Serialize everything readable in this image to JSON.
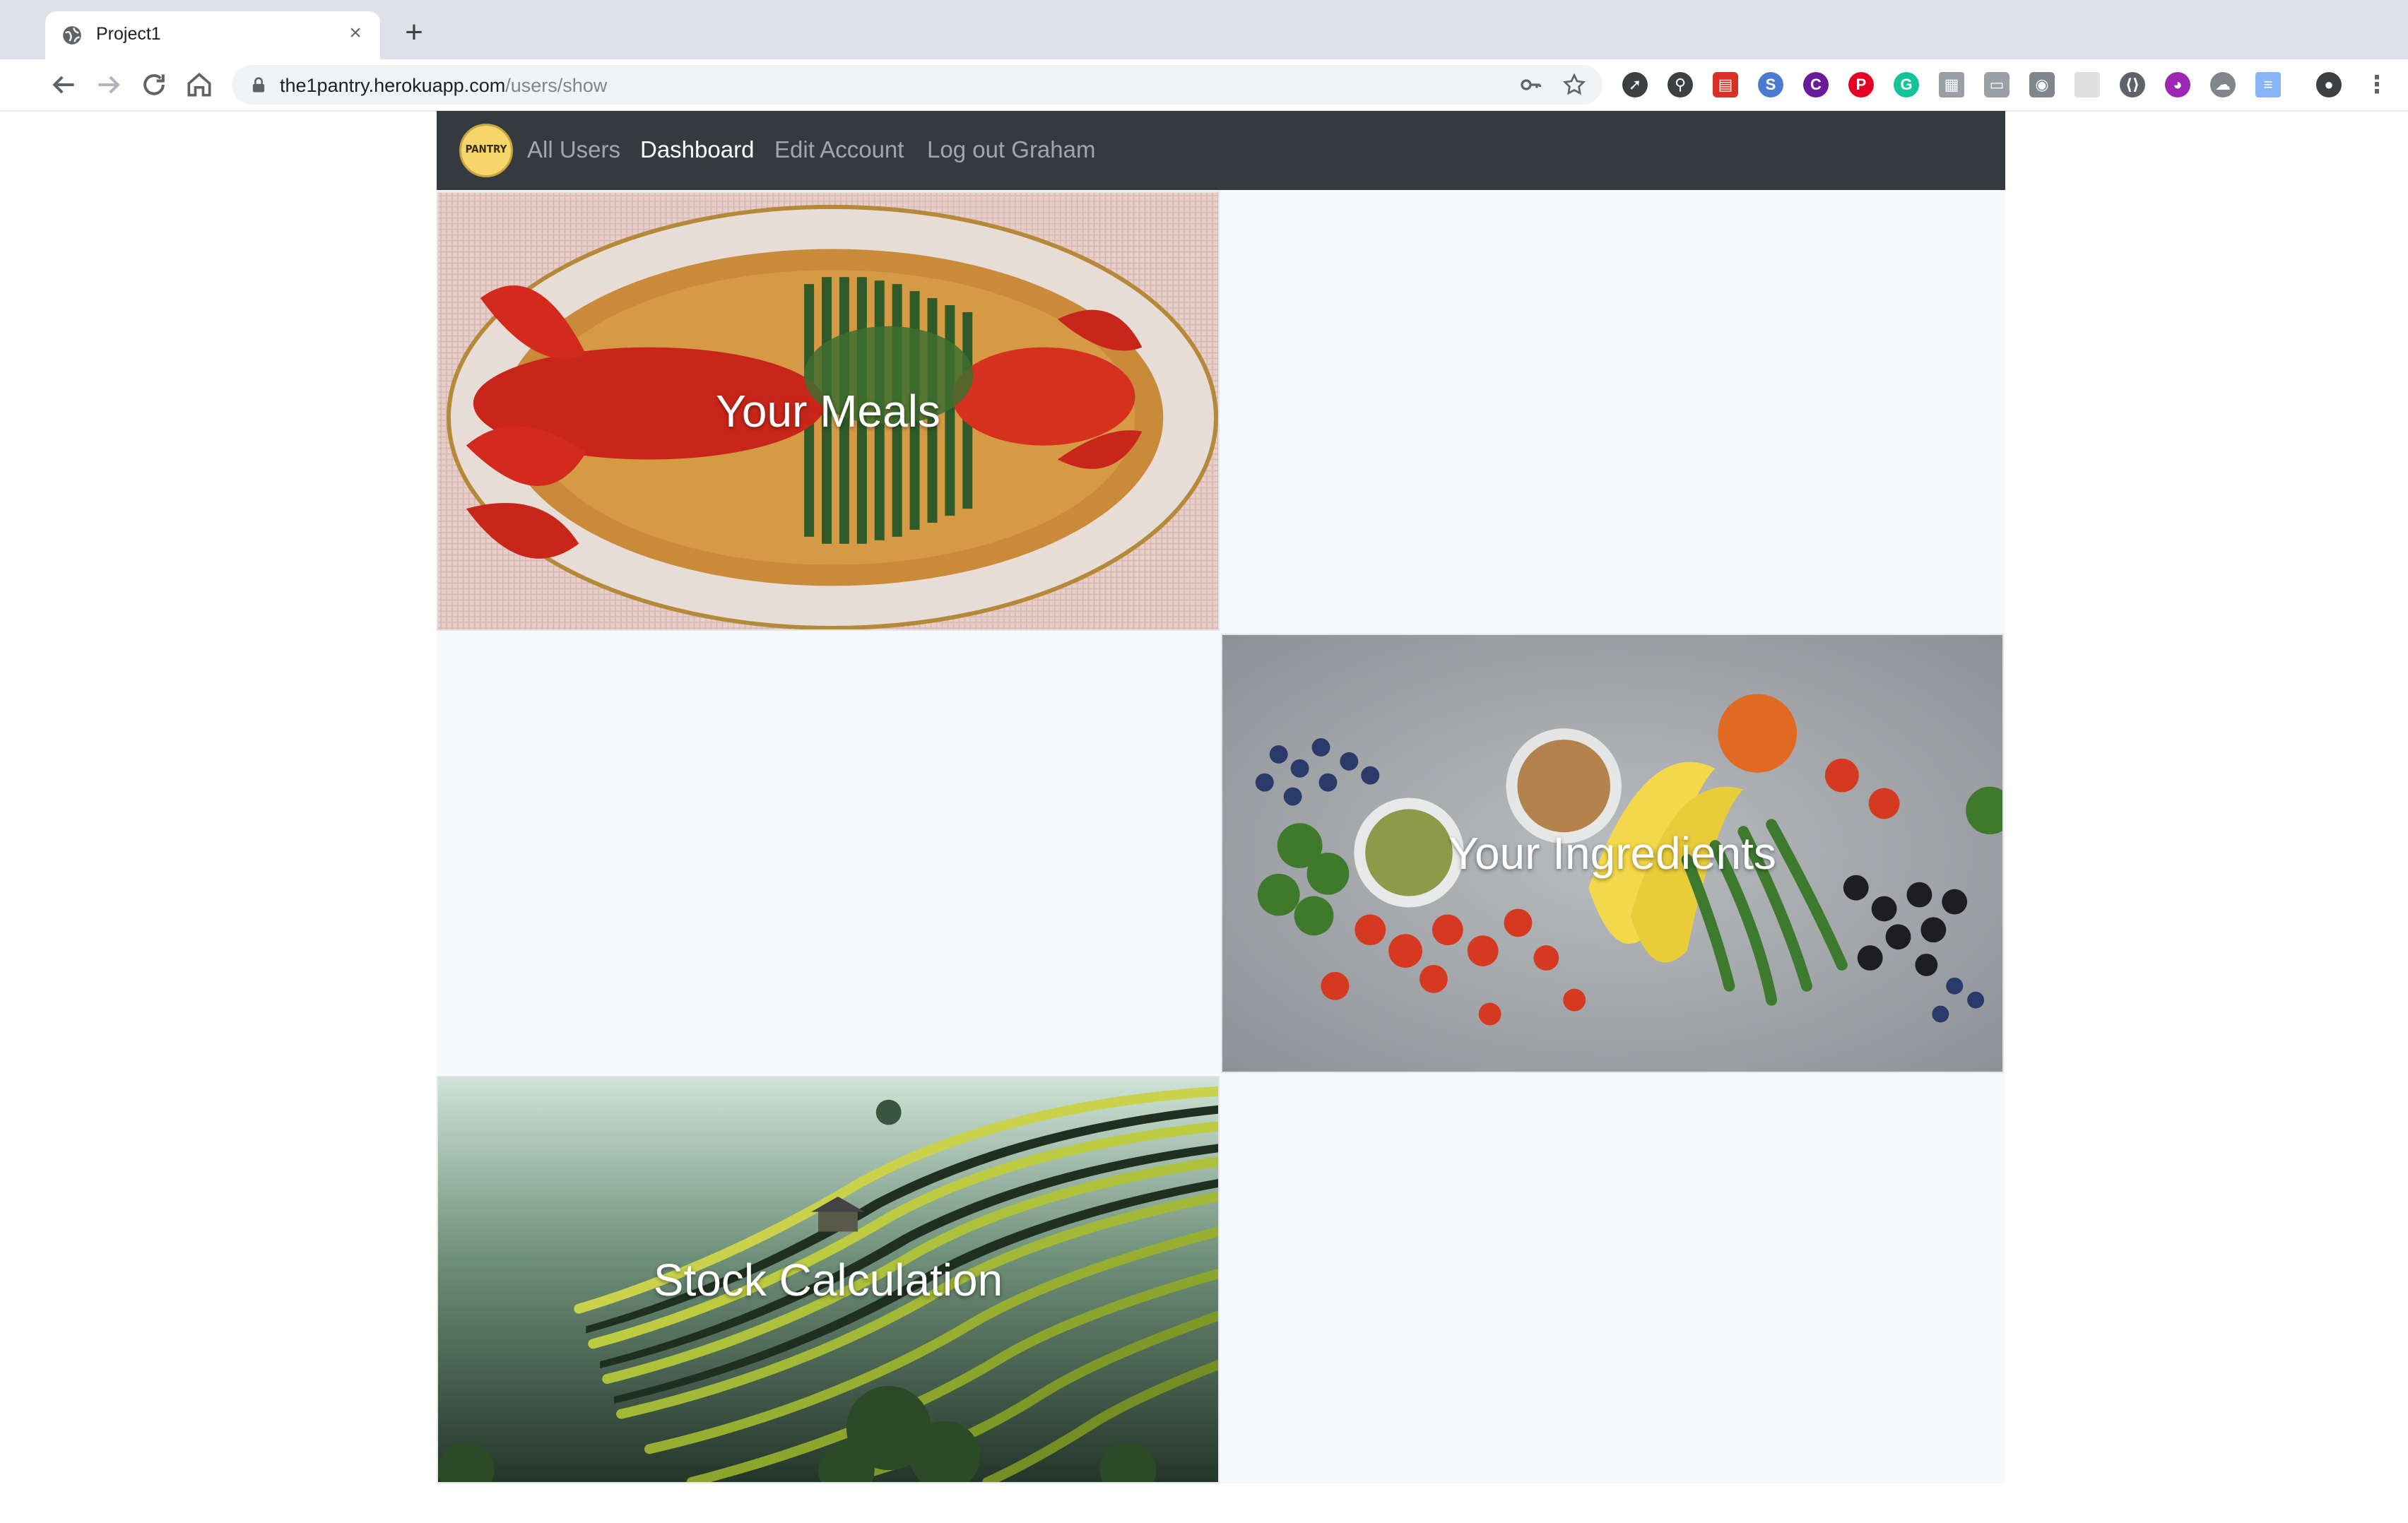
{
  "browser": {
    "tab_title": "Project1",
    "tab_close": "×",
    "new_tab": "+",
    "url_domain": "the1pantry.herokuapp.com",
    "url_path": "/users/show"
  },
  "navbar": {
    "brand": "PANTRY",
    "links": [
      {
        "label": "All Users",
        "active": false
      },
      {
        "label": "Dashboard",
        "active": true
      },
      {
        "label": "Edit Account",
        "active": false
      },
      {
        "label": "Log out Graham",
        "active": false
      }
    ]
  },
  "cards": [
    {
      "title": "Your Meals"
    },
    {
      "title": "Your Ingredients"
    },
    {
      "title": "Stock Calculation"
    }
  ],
  "colors": {
    "navbar_bg": "#343a40",
    "page_bg": "#f8f9fa",
    "tabstrip_bg": "#dee1e6"
  }
}
